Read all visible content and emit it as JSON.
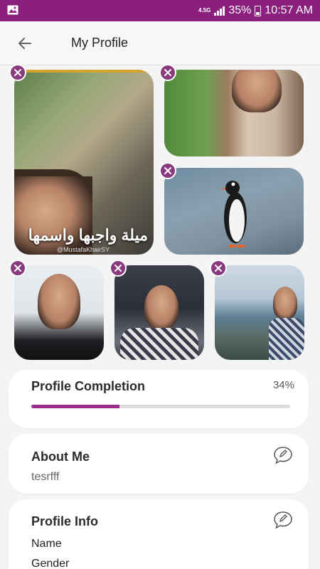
{
  "status_bar": {
    "network": "4.5G",
    "battery_percent": "35%",
    "time": "10:57 AM"
  },
  "header": {
    "title": "My Profile"
  },
  "photos": {
    "photo1_caption": "ميلة واجبها واسمها",
    "photo1_handle": "@MustafaKhairSY"
  },
  "completion": {
    "title": "Profile Completion",
    "percent_label": "34%",
    "value": 0.34
  },
  "about": {
    "title": "About Me",
    "text": "tesrfff"
  },
  "profile_info": {
    "title": "Profile Info",
    "fields": [
      "Name",
      "Gender"
    ]
  },
  "colors": {
    "primary": "#8b1f7d",
    "accent": "#9b2d8f"
  }
}
